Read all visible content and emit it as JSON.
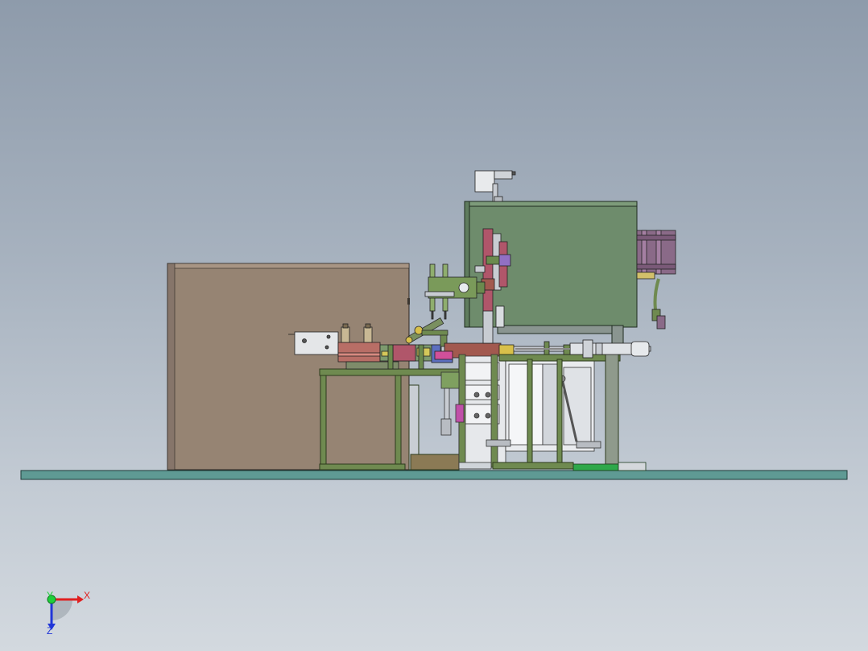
{
  "triad": {
    "x_label": "X",
    "y_label": "Y",
    "z_label": "Z",
    "x_color": "#e02020",
    "y_color": "#1fcf3a",
    "z_color": "#2036d8"
  },
  "colors": {
    "background_top": "#8e9bab",
    "background_bottom": "#d3d9df",
    "base_plate": "#5f9a94",
    "left_cabinet": "#968473",
    "housing": "#6e8c6c",
    "motor": "#8a6a88",
    "frame": "#6f8a50"
  }
}
